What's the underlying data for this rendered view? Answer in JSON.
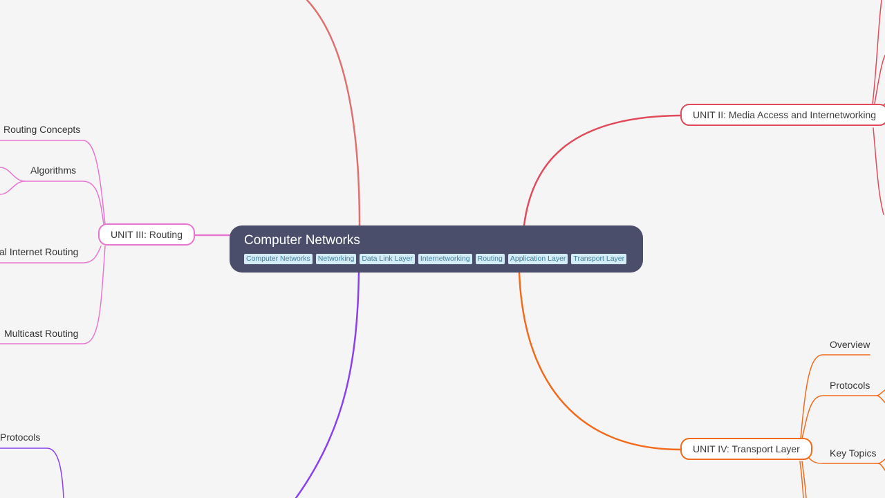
{
  "root": {
    "title": "Computer Networks",
    "tags": [
      "Computer Networks",
      "Networking",
      "Data Link Layer",
      "Internetworking",
      "Routing",
      "Application Layer",
      "Transport Layer"
    ]
  },
  "colors": {
    "background": "#f5f5f5",
    "root_fill": "#4b4e6a",
    "unit1": "#e07070",
    "unit2": "#e14a5a",
    "unit3": "#e876d0",
    "unit4": "#f26a1b",
    "unit5": "#8a3ff0"
  },
  "units": {
    "unit2": {
      "label": "UNIT II: Media Access and Internetworking"
    },
    "unit3": {
      "label": "UNIT III: Routing",
      "children": [
        "Routing Concepts",
        "Algorithms",
        "al Internet Routing",
        "Multicast Routing"
      ]
    },
    "unit4": {
      "label": "UNIT IV: Transport Layer",
      "children": [
        "Overview",
        "Protocols",
        "Key Topics"
      ]
    },
    "unit5": {
      "children": [
        "Protocols"
      ]
    }
  }
}
